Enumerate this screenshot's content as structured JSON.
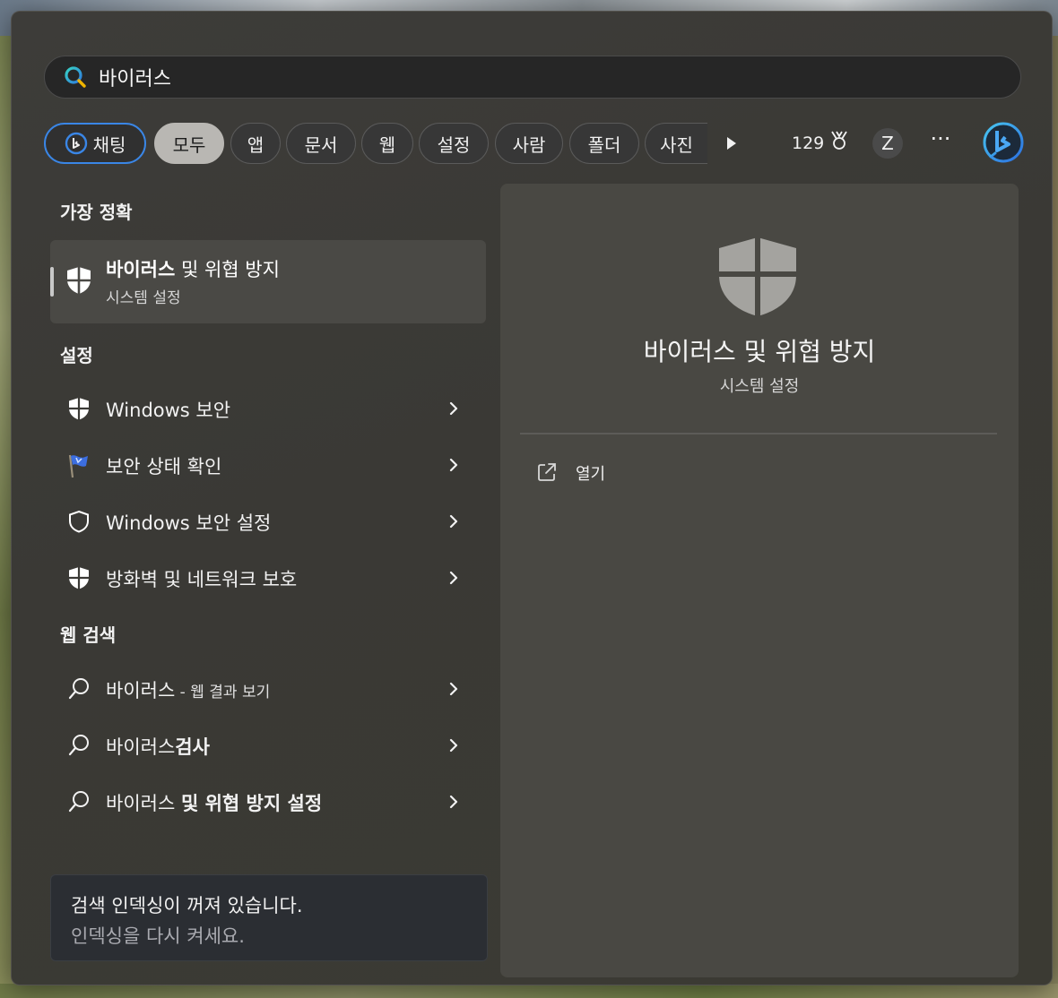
{
  "search": {
    "query": "바이러스",
    "icon": "search-icon"
  },
  "filters": {
    "chat": "채팅",
    "all": "모두",
    "apps": "앱",
    "documents": "문서",
    "web": "웹",
    "settings": "설정",
    "people": "사람",
    "folders": "폴더",
    "photos": "사진",
    "points": "129",
    "avatar_initial": "Z",
    "more": "···"
  },
  "best_match": {
    "heading": "가장 정확",
    "title_bold": "바이러스",
    "title_rest": " 및 위협 방지",
    "subtitle": "시스템 설정"
  },
  "settings_section": {
    "heading": "설정",
    "items": [
      {
        "label": "Windows 보안",
        "icon": "shield-filled-icon"
      },
      {
        "label": "보안 상태 확인",
        "icon": "flag-icon"
      },
      {
        "label": "Windows 보안 설정",
        "icon": "shield-outline-icon"
      },
      {
        "label": "방화벽 및 네트워크 보호",
        "icon": "shield-filled-icon"
      }
    ]
  },
  "web_section": {
    "heading": "웹 검색",
    "items": [
      {
        "prefix": "바이러스",
        "suffix": " - 웹 결과 보기"
      },
      {
        "prefix": "바이러스",
        "suffix": "검사"
      },
      {
        "prefix": "바이러스 ",
        "suffix": "및 위협 방지 설정"
      }
    ]
  },
  "notice": {
    "line1": "검색 인덱싱이 꺼져 있습니다.",
    "line2": "인덱싱을 다시 켜세요."
  },
  "detail": {
    "title": "바이러스 및 위협 방지",
    "subtitle": "시스템 설정",
    "open_label": "열기"
  },
  "colors": {
    "accent": "#3a86e6",
    "panel": "#3b3a36",
    "detail_panel": "#494843",
    "selected_row": "#4a4945"
  }
}
